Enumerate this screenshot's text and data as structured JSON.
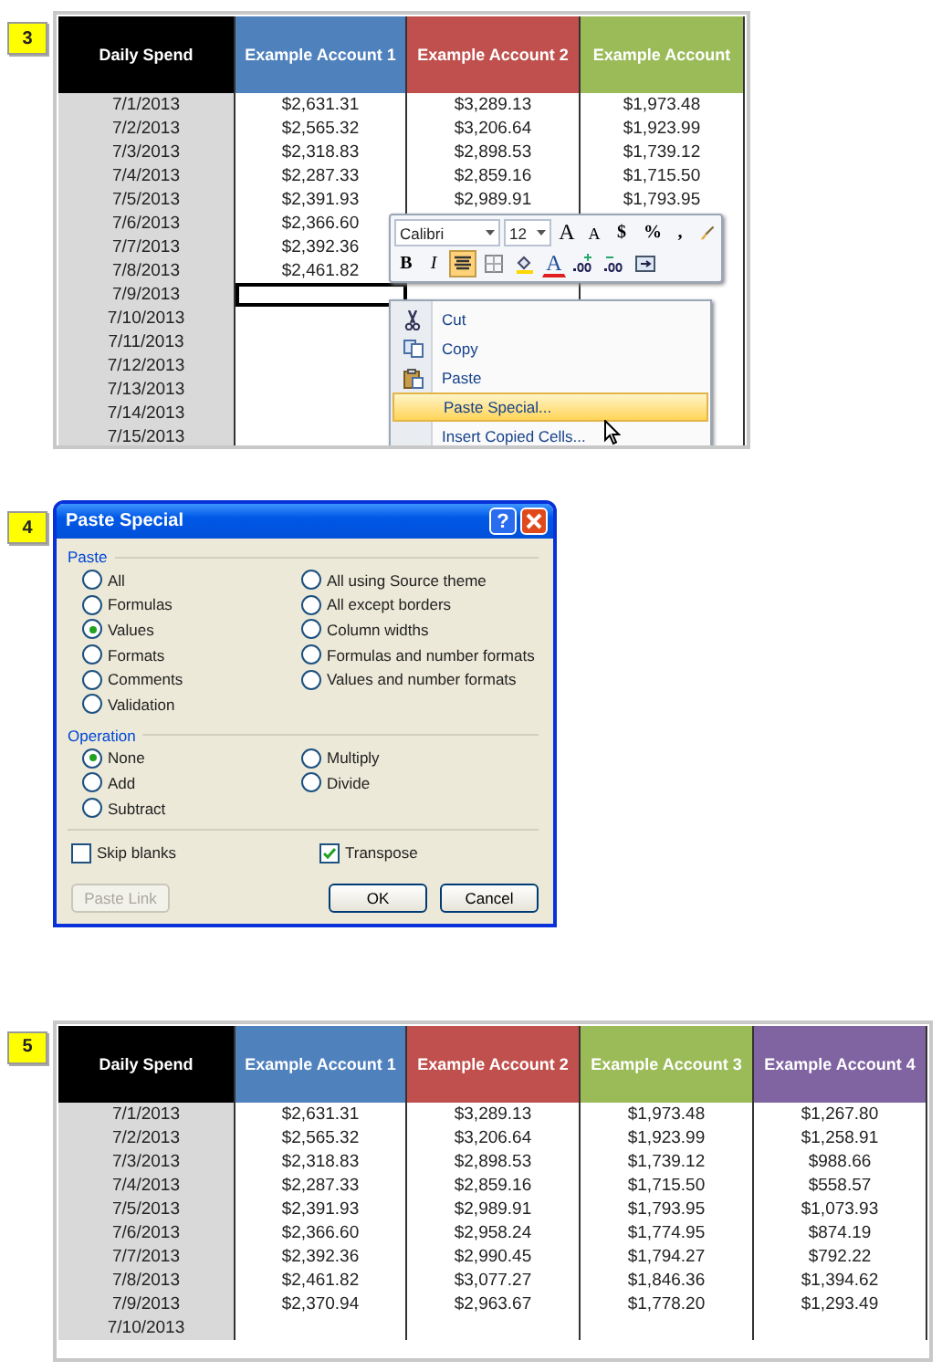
{
  "step_3": {
    "badge": "3",
    "table": {
      "columns": [
        {
          "label": "Daily Spend",
          "color": "#000000"
        },
        {
          "label": "Example Account 1",
          "color": "#4f81bd"
        },
        {
          "label": "Example Account 2",
          "color": "#c0504d"
        },
        {
          "label": "Example Account",
          "color": "#9bbb59"
        }
      ],
      "rows": [
        {
          "date": "7/1/2013",
          "amounts": [
            "$2,631.31",
            "$3,289.13",
            "$1,973.48"
          ],
          "selected": false
        },
        {
          "date": "7/2/2013",
          "amounts": [
            "$2,565.32",
            "$3,206.64",
            "$1,923.99"
          ],
          "selected": false
        },
        {
          "date": "7/3/2013",
          "amounts": [
            "$2,318.83",
            "$2,898.53",
            "$1,739.12"
          ],
          "selected": false
        },
        {
          "date": "7/4/2013",
          "amounts": [
            "$2,287.33",
            "$2,859.16",
            "$1,715.50"
          ],
          "selected": false
        },
        {
          "date": "7/5/2013",
          "amounts": [
            "$2,391.93",
            "$2,989.91",
            "$1,793.95"
          ],
          "selected": false
        },
        {
          "date": "7/6/2013",
          "amounts": [
            "$2,366.60"
          ],
          "selected": false
        },
        {
          "date": "7/7/2013",
          "amounts": [
            "$2,392.36"
          ],
          "selected": false
        },
        {
          "date": "7/8/2013",
          "amounts": [
            "$2,461.82"
          ],
          "selected": false
        },
        {
          "date": "7/9/2013",
          "selected": true
        },
        {
          "date": "7/10/2013",
          "selected": false
        },
        {
          "date": "7/11/2013",
          "selected": false
        },
        {
          "date": "7/12/2013",
          "selected": false
        },
        {
          "date": "7/13/2013",
          "selected": false
        },
        {
          "date": "7/14/2013",
          "selected": false
        },
        {
          "date": "7/15/2013",
          "selected": false
        }
      ]
    },
    "mini_toolbar": {
      "row_1": [
        {
          "kind": "dropdown",
          "label": "Calibri",
          "pressed": false
        },
        {
          "kind": "dropdown",
          "label": "12",
          "pressed": false
        },
        {
          "kind": "grow",
          "label": "A",
          "pressed": false
        },
        {
          "kind": "shrink",
          "label": "A",
          "pressed": false
        },
        {
          "kind": "menu",
          "label": "$",
          "pressed": false
        },
        {
          "kind": "text",
          "label": "%",
          "pressed": false
        },
        {
          "kind": "text",
          "label": ",",
          "pressed": false
        },
        {
          "kind": "brush",
          "pressed": false
        }
      ],
      "row_2": [
        {
          "kind": "bold",
          "label": "B",
          "pressed": false
        },
        {
          "kind": "italic",
          "label": "I",
          "pressed": false
        },
        {
          "kind": "align",
          "pressed": true
        },
        {
          "kind": "borders",
          "pressed": false
        },
        {
          "kind": "fill",
          "pressed": false
        },
        {
          "kind": "fontcolor",
          "label": "A",
          "pressed": false
        },
        {
          "kind": "moredecimals",
          "pressed": false
        },
        {
          "kind": "fewerdecimals",
          "pressed": false
        },
        {
          "kind": "merge",
          "pressed": false
        }
      ]
    },
    "context_menu": [
      {
        "kind": "cut",
        "label": "Cut",
        "selected": false
      },
      {
        "kind": "copy",
        "label": "Copy",
        "selected": false
      },
      {
        "kind": "paste",
        "label": "Paste",
        "selected": false
      },
      {
        "kind": "plain",
        "label": "Paste Special...",
        "selected": true
      },
      {
        "kind": "plain",
        "label": "Insert Copied Cells...",
        "selected": false
      }
    ]
  },
  "step_4": {
    "badge": "4",
    "dialog": {
      "title": "Paste Special",
      "help": "?",
      "paste_label": "Paste",
      "paste_options": [
        {
          "label": "All",
          "selected": false
        },
        {
          "label": "Formulas",
          "selected": false
        },
        {
          "label": "Values",
          "selected": true
        },
        {
          "label": "Formats",
          "selected": false
        },
        {
          "label": "Comments",
          "selected": false
        },
        {
          "label": "Validation",
          "selected": false
        },
        {
          "label": "All using Source theme",
          "selected": false
        },
        {
          "label": "All except borders",
          "selected": false
        },
        {
          "label": "Column widths",
          "selected": false
        },
        {
          "label": "Formulas and number formats",
          "selected": false
        },
        {
          "label": "Values and number formats",
          "selected": false
        }
      ],
      "operation_label": "Operation",
      "operation_options": [
        {
          "label": "None",
          "selected": true
        },
        {
          "label": "Add",
          "selected": false
        },
        {
          "label": "Subtract",
          "selected": false
        },
        {
          "label": "Multiply",
          "selected": false
        },
        {
          "label": "Divide",
          "selected": false
        }
      ],
      "checkboxes": [
        {
          "label": "Skip blanks",
          "checked": false
        },
        {
          "label": "Transpose",
          "checked": true
        }
      ],
      "buttons": [
        {
          "label": "Paste Link",
          "disabled": true
        },
        {
          "label": "OK",
          "disabled": false
        },
        {
          "label": "Cancel",
          "disabled": false
        }
      ]
    }
  },
  "step_5": {
    "badge": "5",
    "table": {
      "columns": [
        {
          "label": "Daily Spend",
          "color": "#000000"
        },
        {
          "label": "Example Account 1",
          "color": "#4f81bd"
        },
        {
          "label": "Example Account 2",
          "color": "#c0504d"
        },
        {
          "label": "Example Account 3",
          "color": "#9bbb59"
        },
        {
          "label": "Example Account 4",
          "color": "#8064a2"
        }
      ],
      "rows": [
        {
          "date": "7/1/2013",
          "amounts": [
            "$2,631.31",
            "$3,289.13",
            "$1,973.48",
            "$1,267.80"
          ]
        },
        {
          "date": "7/2/2013",
          "amounts": [
            "$2,565.32",
            "$3,206.64",
            "$1,923.99",
            "$1,258.91"
          ]
        },
        {
          "date": "7/3/2013",
          "amounts": [
            "$2,318.83",
            "$2,898.53",
            "$1,739.12",
            "$988.66"
          ]
        },
        {
          "date": "7/4/2013",
          "amounts": [
            "$2,287.33",
            "$2,859.16",
            "$1,715.50",
            "$558.57"
          ]
        },
        {
          "date": "7/5/2013",
          "amounts": [
            "$2,391.93",
            "$2,989.91",
            "$1,793.95",
            "$1,073.93"
          ]
        },
        {
          "date": "7/6/2013",
          "amounts": [
            "$2,366.60",
            "$2,958.24",
            "$1,774.95",
            "$874.19"
          ]
        },
        {
          "date": "7/7/2013",
          "amounts": [
            "$2,392.36",
            "$2,990.45",
            "$1,794.27",
            "$792.22"
          ]
        },
        {
          "date": "7/8/2013",
          "amounts": [
            "$2,461.82",
            "$3,077.27",
            "$1,846.36",
            "$1,394.62"
          ]
        },
        {
          "date": "7/9/2013",
          "amounts": [
            "$2,370.94",
            "$2,963.67",
            "$1,778.20",
            "$1,293.49"
          ]
        },
        {
          "date": "7/10/2013"
        }
      ]
    }
  }
}
